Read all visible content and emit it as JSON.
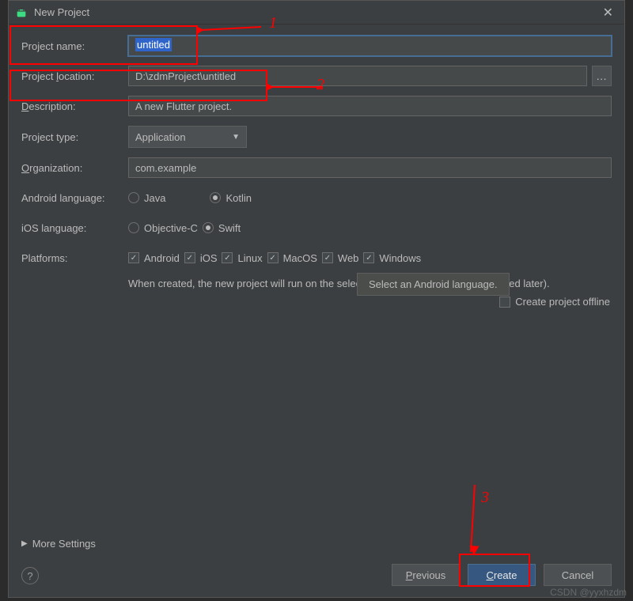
{
  "titlebar": {
    "title": "New Project"
  },
  "labels": {
    "project_name": "Project name:",
    "project_location_pre": "Project ",
    "project_location_mn": "l",
    "project_location_post": "ocation:",
    "description_mn": "D",
    "description_post": "escription:",
    "project_type": "Project type:",
    "organization_mn": "O",
    "organization_post": "rganization:",
    "android_lang": "Android language:",
    "ios_lang": "iOS language:",
    "platforms": "Platforms:"
  },
  "fields": {
    "project_name": "untitled",
    "project_location": "D:\\zdmProject\\untitled",
    "description": "A new Flutter project.",
    "project_type": "Application",
    "organization": "com.example"
  },
  "radios": {
    "android": {
      "java": "Java",
      "java_mn": "J",
      "kotlin": "Kotlin",
      "kotlin_mn": "K",
      "selected": "kotlin"
    },
    "ios": {
      "objc": "Objective-C",
      "objc_mn": "C",
      "swift": "Swift",
      "swift_mn": "S",
      "selected": "swift"
    }
  },
  "platforms": {
    "android": {
      "label": "Android",
      "checked": true
    },
    "ios": {
      "label": "iOS",
      "checked": true
    },
    "linux": {
      "label": "Linux",
      "checked": true
    },
    "macos": {
      "label": "MacOS",
      "checked": true
    },
    "web": {
      "label": "Web",
      "checked": true
    },
    "windows": {
      "label": "Windows",
      "checked": true
    }
  },
  "hints": {
    "platforms_note": "When created, the new project will run on the selected platforms (others can be added later).",
    "offline": "Create project offline",
    "tooltip": "Select an Android language."
  },
  "more_settings": "More Settings",
  "buttons": {
    "previous": "Previous",
    "previous_mn": "P",
    "create": "Create",
    "create_mn": "C",
    "cancel": "Cancel"
  },
  "annotations": {
    "n1": "1",
    "n2": "2",
    "n3": "3"
  },
  "watermark": "CSDN @yyxhzdm"
}
